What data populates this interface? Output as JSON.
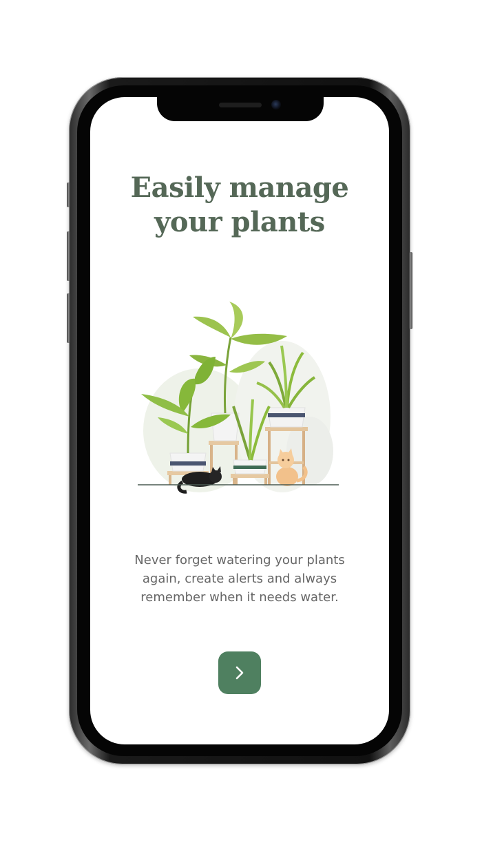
{
  "onboarding": {
    "title_line_1": "Easily manage",
    "title_line_2": "your plants",
    "description_line_1": "Never forget watering your plants",
    "description_line_2": "again, create alerts and always",
    "description_line_3": "remember when it needs water.",
    "next_icon": "chevron-right-icon"
  },
  "colors": {
    "title": "#556857",
    "body_text": "#666666",
    "button": "#4f8060",
    "leaf_green": "#8cbb3c"
  }
}
